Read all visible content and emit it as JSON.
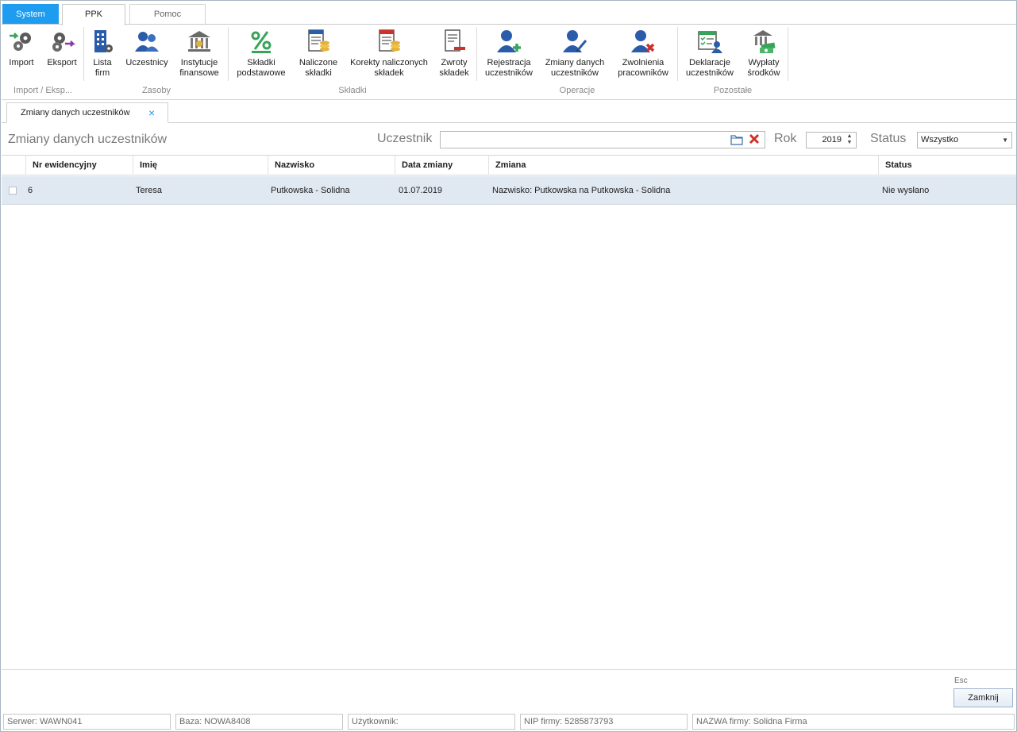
{
  "ribbon_tabs": {
    "system": "System",
    "ppk": "PPK",
    "pomoc": "Pomoc"
  },
  "ribbon": {
    "buttons": {
      "import": [
        "Import",
        ""
      ],
      "eksport": [
        "Eksport",
        ""
      ],
      "lista_firm": [
        "Lista",
        "firm"
      ],
      "uczestnicy": [
        "Uczestnicy",
        ""
      ],
      "instytucje": [
        "Instytucje",
        "finansowe"
      ],
      "skladki_podstawowe": [
        "Składki",
        "podstawowe"
      ],
      "naliczone": [
        "Naliczone",
        "składki"
      ],
      "korekty": [
        "Korekty naliczonych",
        "składek"
      ],
      "zwroty": [
        "Zwroty",
        "składek"
      ],
      "rejestracja": [
        "Rejestracja",
        "uczestników"
      ],
      "zmiany": [
        "Zmiany danych",
        "uczestników"
      ],
      "zwolnienia": [
        "Zwolnienia",
        "pracowników"
      ],
      "deklaracje": [
        "Deklaracje",
        "uczestników"
      ],
      "wyplaty": [
        "Wypłaty",
        "środków"
      ]
    },
    "groups": {
      "import_eksport": "Import / Eksp...",
      "zasoby": "Zasoby",
      "skladki": "Składki",
      "operacje": "Operacje",
      "pozostale": "Pozostałe"
    }
  },
  "doc_tab": {
    "label": "Zmiany danych uczestników",
    "close": "×"
  },
  "filters": {
    "title": "Zmiany danych uczestników",
    "uczestnik_label": "Uczestnik",
    "uczestnik_value": "",
    "rok_label": "Rok",
    "rok_value": "2019",
    "status_label": "Status",
    "status_value": "Wszystko"
  },
  "grid": {
    "columns": [
      "Nr ewidencyjny",
      "Imię",
      "Nazwisko",
      "Data zmiany",
      "Zmiana",
      "Status"
    ],
    "rows": [
      {
        "nr": "6",
        "imie": "Teresa",
        "nazwisko": "Putkowska - Solidna",
        "data": "01.07.2019",
        "zmiana": "Nazwisko: Putkowska na Putkowska - Solidna",
        "status": "Nie wysłano"
      }
    ]
  },
  "bottom": {
    "esc": "Esc",
    "close": "Zamknij"
  },
  "statusbar": {
    "serwer": "Serwer: WAWN041",
    "baza": "Baza: NOWA8408",
    "uzytkownik": "Użytkownik:",
    "nip": "NIP firmy: 5285873793",
    "nazwa": "NAZWA firmy: Solidna Firma"
  },
  "colors": {
    "accent": "#1e9cf0",
    "selected_row": "#e0e8f2",
    "icon_blue": "#2a5caa",
    "icon_green": "#3aa35a",
    "icon_red": "#d0302a"
  }
}
